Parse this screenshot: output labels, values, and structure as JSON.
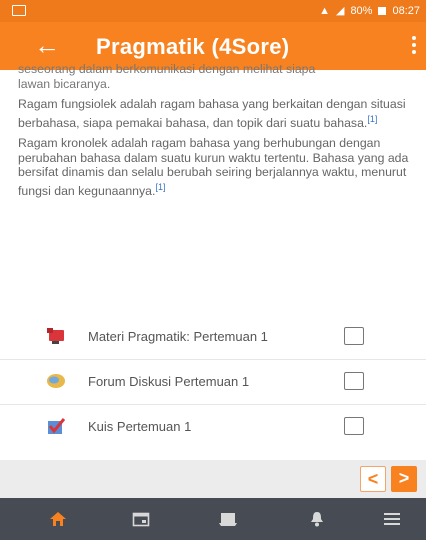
{
  "status_bar": {
    "battery": "80%",
    "time": "08:27"
  },
  "app_bar": {
    "title": "Pragmatik (4Sore)"
  },
  "content": {
    "cut_line_1": "seseorang dalam berkomunikasi dengan melihat siapa",
    "cut_line_2": "lawan bicaranya.",
    "para_fungsiolek": "Ragam fungsiolek adalah ragam bahasa yang berkaitan dengan situasi berbahasa, siapa pemakai bahasa, dan topik dari suatu bahasa.",
    "footnote_1": "[1]",
    "para_kronolek": "Ragam kronolek adalah ragam bahasa yang berhubungan dengan perubahan bahasa dalam suatu kurun waktu tertentu. Bahasa yang ada bersifat dinamis dan selalu berubah seiring berjalannya waktu, menurut fungsi dan kegunaannya.",
    "footnote_2": "[1]"
  },
  "activities": [
    {
      "label": "Materi Pragmatik: Pertemuan 1",
      "icon": "slides-icon",
      "color": "#d9353a",
      "checked": false
    },
    {
      "label": "Forum Diskusi Pertemuan 1",
      "icon": "forum-icon",
      "color": "#e8b84a",
      "checked": false
    },
    {
      "label": "Kuis Pertemuan 1",
      "icon": "quiz-icon",
      "color": "#5a8fd6",
      "checked": false
    }
  ],
  "pager": {
    "prev": "<",
    "next": ">"
  },
  "bottom_nav": [
    "home-icon",
    "calendar-icon",
    "courses-icon",
    "notifications-icon",
    "more-menu-icon"
  ],
  "colors": {
    "accent": "#f7821f",
    "status_bar": "#ee7a1b",
    "bottom_nav": "#474c54"
  }
}
